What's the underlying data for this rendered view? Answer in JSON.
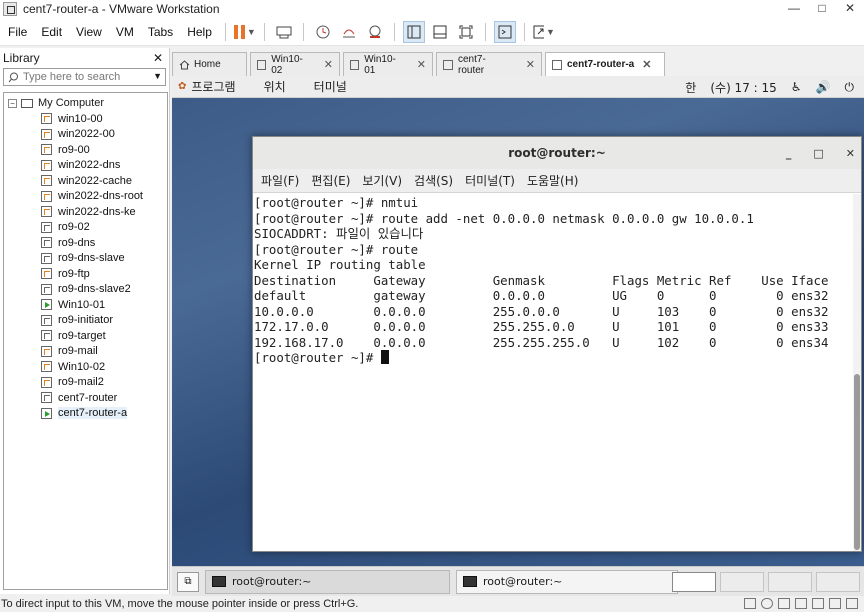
{
  "window": {
    "title": "cent7-router-a - VMware Workstation",
    "controls": [
      "—",
      "□",
      "✕"
    ]
  },
  "menubar": {
    "items": [
      "File",
      "Edit",
      "View",
      "VM",
      "Tabs",
      "Help"
    ]
  },
  "library": {
    "title": "Library",
    "close": "✕",
    "search_placeholder": "Type here to search",
    "root": "My Computer",
    "items": [
      {
        "label": "win10-00",
        "icon": "win"
      },
      {
        "label": "win2022-00",
        "icon": "win"
      },
      {
        "label": "ro9-00",
        "icon": "win"
      },
      {
        "label": "win2022-dns",
        "icon": "win"
      },
      {
        "label": "win2022-cache",
        "icon": "win"
      },
      {
        "label": "win2022-dns-root",
        "icon": "win"
      },
      {
        "label": "win2022-dns-ke",
        "icon": "win"
      },
      {
        "label": "ro9-02",
        "icon": "linux"
      },
      {
        "label": "ro9-dns",
        "icon": "linux"
      },
      {
        "label": "ro9-dns-slave",
        "icon": "linux"
      },
      {
        "label": "ro9-ftp",
        "icon": "win"
      },
      {
        "label": "ro9-dns-slave2",
        "icon": "linux"
      },
      {
        "label": "Win10-01",
        "icon": "running"
      },
      {
        "label": "ro9-initiator",
        "icon": "linux"
      },
      {
        "label": "ro9-target",
        "icon": "linux"
      },
      {
        "label": "ro9-mail",
        "icon": "win"
      },
      {
        "label": "Win10-02",
        "icon": "win"
      },
      {
        "label": "ro9-mail2",
        "icon": "win"
      },
      {
        "label": "cent7-router",
        "icon": "linux"
      },
      {
        "label": "cent7-router-a",
        "icon": "running"
      }
    ]
  },
  "tabs": [
    {
      "label": "Home",
      "icon": "home-icon"
    },
    {
      "label": "Win10-02",
      "icon": "vm-icon"
    },
    {
      "label": "Win10-01",
      "icon": "vm-running-icon"
    },
    {
      "label": "cent7-router",
      "icon": "vm-icon"
    },
    {
      "label": "cent7-router-a",
      "icon": "vm-running-icon"
    }
  ],
  "tab_close": "✕",
  "gnome": {
    "menus": [
      "프로그램",
      "위치",
      "터미널"
    ],
    "input_method": "한",
    "clock": "(수) 17 : 15"
  },
  "terminal": {
    "title": "root@router:~",
    "controls": [
      "_",
      "□",
      "✕"
    ],
    "menu": [
      "파일(F)",
      "편집(E)",
      "보기(V)",
      "검색(S)",
      "터미널(T)",
      "도움말(H)"
    ],
    "lines": [
      "[root@router ~]# nmtui",
      "[root@router ~]# route add -net 0.0.0.0 netmask 0.0.0.0 gw 10.0.0.1",
      "SIOCADDRT: 파일이 있습니다",
      "[root@router ~]# route",
      "Kernel IP routing table",
      "Destination     Gateway         Genmask         Flags Metric Ref    Use Iface",
      "default         gateway         0.0.0.0         UG    0      0        0 ens32",
      "10.0.0.0        0.0.0.0         255.0.0.0       U     103    0        0 ens32",
      "172.17.0.0      0.0.0.0         255.255.0.0     U     101    0        0 ens33",
      "192.168.17.0    0.0.0.0         255.255.255.0   U     102    0        0 ens34"
    ],
    "prompt": "[root@router ~]# "
  },
  "taskbar": {
    "items": [
      "root@router:~",
      "root@router:~"
    ]
  },
  "status": {
    "text": "To direct input to this VM, move the mouse pointer inside or press Ctrl+G."
  }
}
